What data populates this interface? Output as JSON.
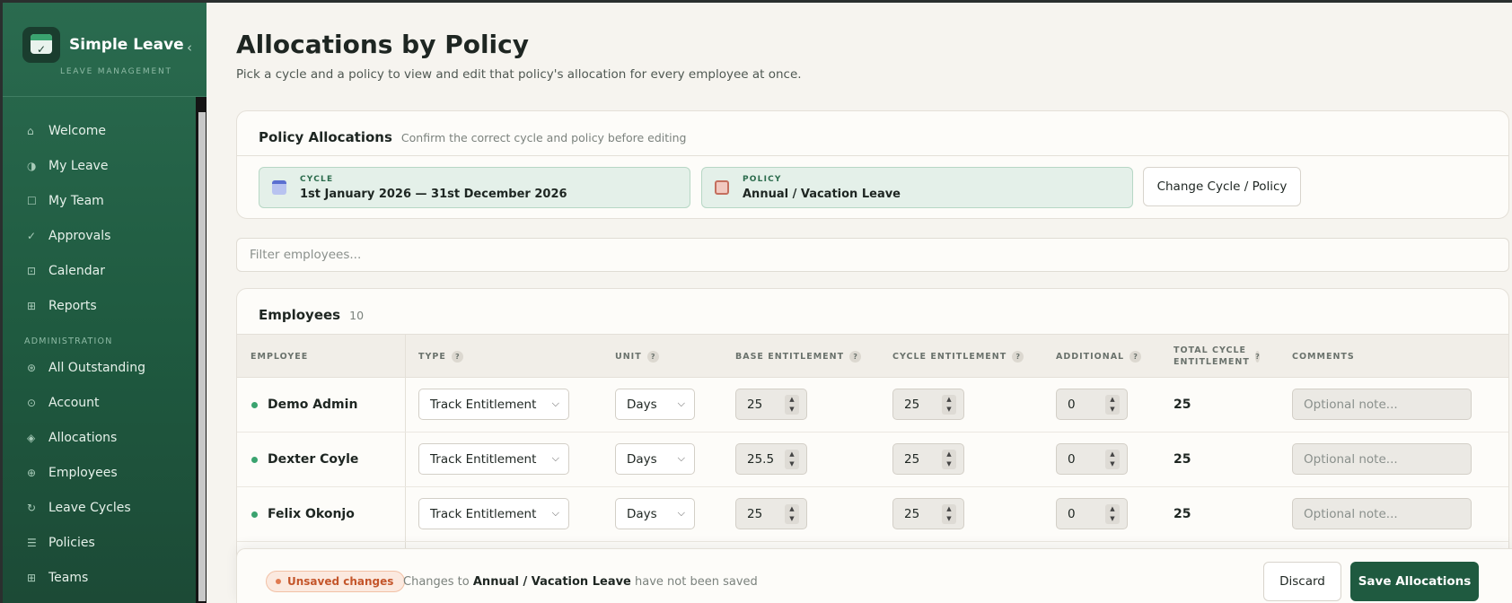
{
  "app": {
    "name": "Simple Leave",
    "subtitle": "LEAVE MANAGEMENT",
    "collapse_icon": "chevron-left-icon"
  },
  "sidebar": {
    "items": [
      {
        "label": "Welcome",
        "icon": "⌂"
      },
      {
        "label": "My Leave",
        "icon": "◑"
      },
      {
        "label": "My Team",
        "icon": "☐"
      },
      {
        "label": "Approvals",
        "icon": "✓"
      },
      {
        "label": "Calendar",
        "icon": "⊡"
      },
      {
        "label": "Reports",
        "icon": "⊞"
      }
    ],
    "section_label": "ADMINISTRATION",
    "admin_items": [
      {
        "label": "All Outstanding",
        "icon": "⊛"
      },
      {
        "label": "Account",
        "icon": "⊙"
      },
      {
        "label": "Allocations",
        "icon": "◈"
      },
      {
        "label": "Employees",
        "icon": "⊕"
      },
      {
        "label": "Leave Cycles",
        "icon": "↻"
      },
      {
        "label": "Policies",
        "icon": "☰"
      },
      {
        "label": "Teams",
        "icon": "⊞"
      }
    ]
  },
  "page": {
    "title": "Allocations by Policy",
    "subtitle": "Pick a cycle and a policy to view and edit that policy's allocation for every employee at once."
  },
  "policy_card": {
    "title": "Policy Allocations",
    "hint": "Confirm the correct cycle and policy before editing",
    "cycle_label": "CYCLE",
    "cycle_value": "1st January 2026 — 31st December 2026",
    "policy_label": "POLICY",
    "policy_value": "Annual / Vacation Leave",
    "change_button": "Change Cycle / Policy"
  },
  "filter": {
    "placeholder": "Filter employees..."
  },
  "employees": {
    "title": "Employees",
    "count": "10",
    "help_glyph": "?",
    "columns": {
      "employee": "EMPLOYEE",
      "type": "TYPE",
      "unit": "UNIT",
      "base": "BASE ENTITLEMENT",
      "cycle": "CYCLE ENTITLEMENT",
      "additional": "ADDITIONAL",
      "total": "TOTAL CYCLE ENTITLEMENT",
      "comments": "COMMENTS"
    },
    "comment_placeholder": "Optional note...",
    "rows": [
      {
        "name": "Demo Admin",
        "type": "Track Entitlement",
        "unit": "Days",
        "base": "25",
        "cycle": "25",
        "additional": "0",
        "total": "25"
      },
      {
        "name": "Dexter Coyle",
        "type": "Track Entitlement",
        "unit": "Days",
        "base": "25.5",
        "cycle": "25",
        "additional": "0",
        "total": "25"
      },
      {
        "name": "Felix Okonjo",
        "type": "Track Entitlement",
        "unit": "Days",
        "base": "25",
        "cycle": "25",
        "additional": "0",
        "total": "25"
      }
    ]
  },
  "savebar": {
    "badge": "Unsaved changes",
    "msg_prefix": "Changes to",
    "msg_policy": "Annual / Vacation Leave",
    "msg_suffix": "have not been saved",
    "discard": "Discard",
    "save": "Save Allocations"
  },
  "colors": {
    "brand": "#1f5a40",
    "accent": "#3aa36f",
    "warning": "#c4562b"
  }
}
